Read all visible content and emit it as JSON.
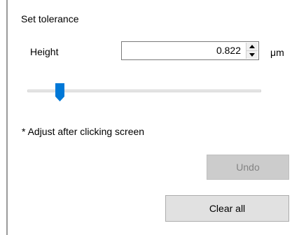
{
  "section_title": "Set tolerance",
  "height": {
    "label": "Height",
    "value": "0.822",
    "unit": "μm"
  },
  "slider": {
    "level": 0.126,
    "accent_color": "#0078d7"
  },
  "note": "* Adjust after clicking screen",
  "buttons": {
    "undo": {
      "label": "Undo",
      "enabled": false
    },
    "clear_all": {
      "label": "Clear all",
      "enabled": true
    }
  },
  "icons": {
    "spin_up": "triangle-up-icon",
    "spin_down": "triangle-down-icon"
  }
}
